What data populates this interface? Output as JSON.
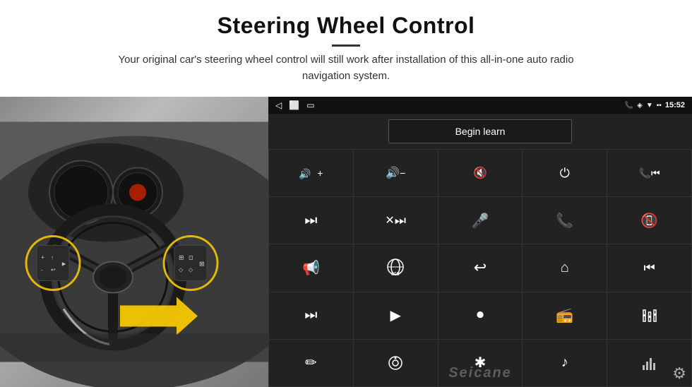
{
  "header": {
    "title": "Steering Wheel Control",
    "subtitle": "Your original car's steering wheel control will still work after installation of this all-in-one auto radio navigation system."
  },
  "android_unit": {
    "status_bar": {
      "time": "15:52",
      "nav_back": "◁",
      "nav_home": "○",
      "nav_recents": "□"
    },
    "begin_learn_label": "Begin learn",
    "controls": [
      {
        "icon": "🔊+",
        "label": "vol-up"
      },
      {
        "icon": "🔊-",
        "label": "vol-down"
      },
      {
        "icon": "🔇",
        "label": "mute"
      },
      {
        "icon": "⏻",
        "label": "power"
      },
      {
        "icon": "⏮",
        "label": "prev-track-phone"
      },
      {
        "icon": "⏭",
        "label": "next"
      },
      {
        "icon": "⏹",
        "label": "stop"
      },
      {
        "icon": "🎤",
        "label": "mic"
      },
      {
        "icon": "📞",
        "label": "call"
      },
      {
        "icon": "📵",
        "label": "hangup"
      },
      {
        "icon": "📢",
        "label": "speaker"
      },
      {
        "icon": "360",
        "label": "360"
      },
      {
        "icon": "↩",
        "label": "back"
      },
      {
        "icon": "⌂",
        "label": "home"
      },
      {
        "icon": "⏮⏮",
        "label": "rewind"
      },
      {
        "icon": "⏭⏭",
        "label": "fast-forward"
      },
      {
        "icon": "▶",
        "label": "play"
      },
      {
        "icon": "⏺",
        "label": "source"
      },
      {
        "icon": "📻",
        "label": "radio"
      },
      {
        "icon": "⚙",
        "label": "eq"
      },
      {
        "icon": "✏",
        "label": "pen"
      },
      {
        "icon": "⊙",
        "label": "knob"
      },
      {
        "icon": "✱",
        "label": "bluetooth"
      },
      {
        "icon": "♪",
        "label": "music"
      },
      {
        "icon": "📊",
        "label": "spectrum"
      }
    ],
    "watermark": "Seicane"
  }
}
